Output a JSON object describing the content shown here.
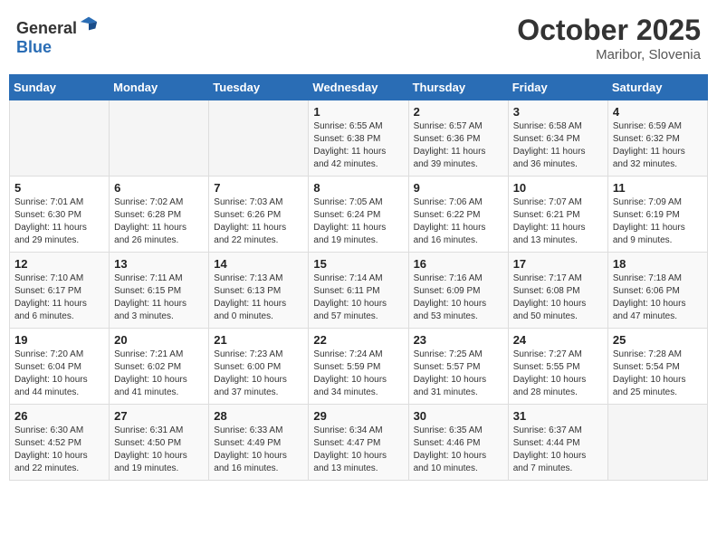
{
  "header": {
    "logo_general": "General",
    "logo_blue": "Blue",
    "month": "October 2025",
    "location": "Maribor, Slovenia"
  },
  "weekdays": [
    "Sunday",
    "Monday",
    "Tuesday",
    "Wednesday",
    "Thursday",
    "Friday",
    "Saturday"
  ],
  "weeks": [
    [
      {
        "day": "",
        "info": ""
      },
      {
        "day": "",
        "info": ""
      },
      {
        "day": "",
        "info": ""
      },
      {
        "day": "1",
        "info": "Sunrise: 6:55 AM\nSunset: 6:38 PM\nDaylight: 11 hours and 42 minutes."
      },
      {
        "day": "2",
        "info": "Sunrise: 6:57 AM\nSunset: 6:36 PM\nDaylight: 11 hours and 39 minutes."
      },
      {
        "day": "3",
        "info": "Sunrise: 6:58 AM\nSunset: 6:34 PM\nDaylight: 11 hours and 36 minutes."
      },
      {
        "day": "4",
        "info": "Sunrise: 6:59 AM\nSunset: 6:32 PM\nDaylight: 11 hours and 32 minutes."
      }
    ],
    [
      {
        "day": "5",
        "info": "Sunrise: 7:01 AM\nSunset: 6:30 PM\nDaylight: 11 hours and 29 minutes."
      },
      {
        "day": "6",
        "info": "Sunrise: 7:02 AM\nSunset: 6:28 PM\nDaylight: 11 hours and 26 minutes."
      },
      {
        "day": "7",
        "info": "Sunrise: 7:03 AM\nSunset: 6:26 PM\nDaylight: 11 hours and 22 minutes."
      },
      {
        "day": "8",
        "info": "Sunrise: 7:05 AM\nSunset: 6:24 PM\nDaylight: 11 hours and 19 minutes."
      },
      {
        "day": "9",
        "info": "Sunrise: 7:06 AM\nSunset: 6:22 PM\nDaylight: 11 hours and 16 minutes."
      },
      {
        "day": "10",
        "info": "Sunrise: 7:07 AM\nSunset: 6:21 PM\nDaylight: 11 hours and 13 minutes."
      },
      {
        "day": "11",
        "info": "Sunrise: 7:09 AM\nSunset: 6:19 PM\nDaylight: 11 hours and 9 minutes."
      }
    ],
    [
      {
        "day": "12",
        "info": "Sunrise: 7:10 AM\nSunset: 6:17 PM\nDaylight: 11 hours and 6 minutes."
      },
      {
        "day": "13",
        "info": "Sunrise: 7:11 AM\nSunset: 6:15 PM\nDaylight: 11 hours and 3 minutes."
      },
      {
        "day": "14",
        "info": "Sunrise: 7:13 AM\nSunset: 6:13 PM\nDaylight: 11 hours and 0 minutes."
      },
      {
        "day": "15",
        "info": "Sunrise: 7:14 AM\nSunset: 6:11 PM\nDaylight: 10 hours and 57 minutes."
      },
      {
        "day": "16",
        "info": "Sunrise: 7:16 AM\nSunset: 6:09 PM\nDaylight: 10 hours and 53 minutes."
      },
      {
        "day": "17",
        "info": "Sunrise: 7:17 AM\nSunset: 6:08 PM\nDaylight: 10 hours and 50 minutes."
      },
      {
        "day": "18",
        "info": "Sunrise: 7:18 AM\nSunset: 6:06 PM\nDaylight: 10 hours and 47 minutes."
      }
    ],
    [
      {
        "day": "19",
        "info": "Sunrise: 7:20 AM\nSunset: 6:04 PM\nDaylight: 10 hours and 44 minutes."
      },
      {
        "day": "20",
        "info": "Sunrise: 7:21 AM\nSunset: 6:02 PM\nDaylight: 10 hours and 41 minutes."
      },
      {
        "day": "21",
        "info": "Sunrise: 7:23 AM\nSunset: 6:00 PM\nDaylight: 10 hours and 37 minutes."
      },
      {
        "day": "22",
        "info": "Sunrise: 7:24 AM\nSunset: 5:59 PM\nDaylight: 10 hours and 34 minutes."
      },
      {
        "day": "23",
        "info": "Sunrise: 7:25 AM\nSunset: 5:57 PM\nDaylight: 10 hours and 31 minutes."
      },
      {
        "day": "24",
        "info": "Sunrise: 7:27 AM\nSunset: 5:55 PM\nDaylight: 10 hours and 28 minutes."
      },
      {
        "day": "25",
        "info": "Sunrise: 7:28 AM\nSunset: 5:54 PM\nDaylight: 10 hours and 25 minutes."
      }
    ],
    [
      {
        "day": "26",
        "info": "Sunrise: 6:30 AM\nSunset: 4:52 PM\nDaylight: 10 hours and 22 minutes."
      },
      {
        "day": "27",
        "info": "Sunrise: 6:31 AM\nSunset: 4:50 PM\nDaylight: 10 hours and 19 minutes."
      },
      {
        "day": "28",
        "info": "Sunrise: 6:33 AM\nSunset: 4:49 PM\nDaylight: 10 hours and 16 minutes."
      },
      {
        "day": "29",
        "info": "Sunrise: 6:34 AM\nSunset: 4:47 PM\nDaylight: 10 hours and 13 minutes."
      },
      {
        "day": "30",
        "info": "Sunrise: 6:35 AM\nSunset: 4:46 PM\nDaylight: 10 hours and 10 minutes."
      },
      {
        "day": "31",
        "info": "Sunrise: 6:37 AM\nSunset: 4:44 PM\nDaylight: 10 hours and 7 minutes."
      },
      {
        "day": "",
        "info": ""
      }
    ]
  ]
}
